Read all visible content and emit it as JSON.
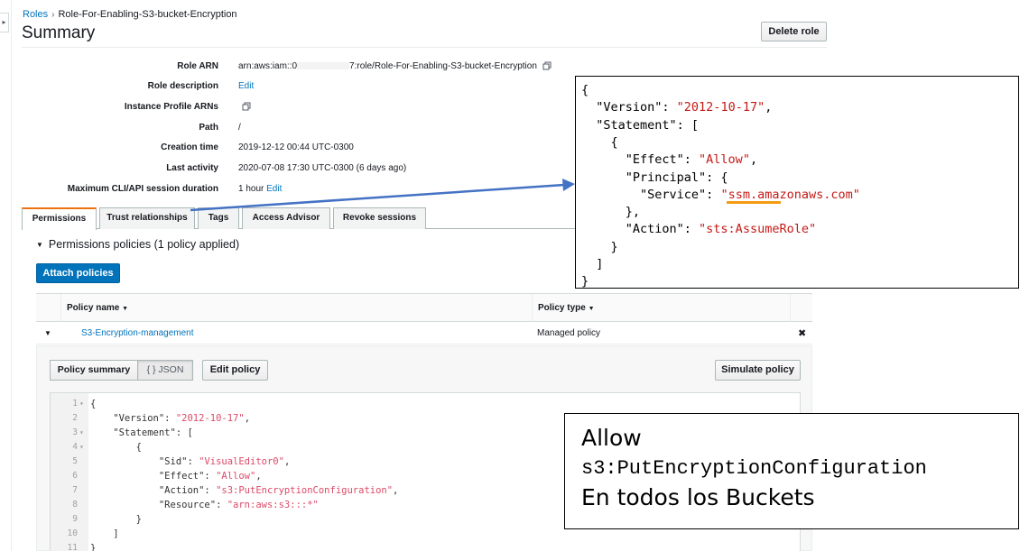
{
  "breadcrumb": {
    "root": "Roles",
    "current": "Role-For-Enabling-S3-bucket-Encryption"
  },
  "page": {
    "title": "Summary",
    "delete_button": "Delete role"
  },
  "summary": {
    "role_arn_label": "Role ARN",
    "role_arn_prefix": "arn:aws:iam::0",
    "role_arn_suffix": "7:role/Role-For-Enabling-S3-bucket-Encryption",
    "role_description_label": "Role description",
    "role_description_edit": "Edit",
    "instance_profile_label": "Instance Profile ARNs",
    "path_label": "Path",
    "path_value": "/",
    "creation_time_label": "Creation time",
    "creation_time_value": "2019-12-12 00:44 UTC-0300",
    "last_activity_label": "Last activity",
    "last_activity_value": "2020-07-08 17:30 UTC-0300 (6 days ago)",
    "max_session_label": "Maximum CLI/API session duration",
    "max_session_value": "1 hour",
    "max_session_edit": "Edit"
  },
  "tabs": [
    "Permissions",
    "Trust relationships",
    "Tags",
    "Access Advisor",
    "Revoke sessions"
  ],
  "permissions": {
    "heading": "Permissions policies (1 policy applied)",
    "attach_button": "Attach policies",
    "col_policy_name": "Policy name",
    "col_policy_type": "Policy type",
    "row_name": "S3-Encryption-management",
    "row_type": "Managed policy",
    "remove_glyph": "✖"
  },
  "policy_panel": {
    "summary_btn": "Policy summary",
    "json_btn": "{ } JSON",
    "edit_btn": "Edit policy",
    "simulate_btn": "Simulate policy"
  },
  "editor_lines": [
    {
      "n": "1",
      "fold": "▾",
      "pre": "{",
      "str": "",
      "post": ""
    },
    {
      "n": "2",
      "fold": "",
      "pre": "    \"Version\": ",
      "str": "\"2012-10-17\"",
      "post": ","
    },
    {
      "n": "3",
      "fold": "▾",
      "pre": "    \"Statement\": [",
      "str": "",
      "post": ""
    },
    {
      "n": "4",
      "fold": "▾",
      "pre": "        {",
      "str": "",
      "post": ""
    },
    {
      "n": "5",
      "fold": "",
      "pre": "            \"Sid\": ",
      "str": "\"VisualEditor0\"",
      "post": ","
    },
    {
      "n": "6",
      "fold": "",
      "pre": "            \"Effect\": ",
      "str": "\"Allow\"",
      "post": ","
    },
    {
      "n": "7",
      "fold": "",
      "pre": "            \"Action\": ",
      "str": "\"s3:PutEncryptionConfiguration\"",
      "post": ","
    },
    {
      "n": "8",
      "fold": "",
      "pre": "            \"Resource\": ",
      "str": "\"arn:aws:s3:::*\"",
      "post": ""
    },
    {
      "n": "9",
      "fold": "",
      "pre": "        }",
      "str": "",
      "post": ""
    },
    {
      "n": "10",
      "fold": "",
      "pre": "    ]",
      "str": "",
      "post": ""
    },
    {
      "n": "11",
      "fold": "",
      "pre": "}",
      "str": "",
      "post": ""
    }
  ],
  "trust_popup_lines": [
    {
      "pre": "{",
      "str": "",
      "post": ""
    },
    {
      "pre": "  \"Version\": ",
      "str": "\"2012-10-17\"",
      "post": ","
    },
    {
      "pre": "  \"Statement\": [",
      "str": "",
      "post": ""
    },
    {
      "pre": "    {",
      "str": "",
      "post": ""
    },
    {
      "pre": "      \"Effect\": ",
      "str": "\"Allow\"",
      "post": ","
    },
    {
      "pre": "      \"Principal\": {",
      "str": "",
      "post": ""
    },
    {
      "pre": "        \"Service\": ",
      "str": "\"ssm.amazonaws.com\"",
      "post": ""
    },
    {
      "pre": "      },",
      "str": "",
      "post": ""
    },
    {
      "pre": "      \"Action\": ",
      "str": "\"sts:AssumeRole\"",
      "post": ""
    },
    {
      "pre": "    }",
      "str": "",
      "post": ""
    },
    {
      "pre": "  ]",
      "str": "",
      "post": ""
    },
    {
      "pre": "}",
      "str": "",
      "post": ""
    }
  ],
  "caption": {
    "line1": "Allow",
    "line2": "s3:PutEncryptionConfiguration",
    "line3": "En todos los Buckets"
  },
  "colors": {
    "link": "#0073bb",
    "primary_button": "#0073bb",
    "active_tab_accent": "#ec7211",
    "arrow": "#4472c4",
    "highlight_underline": "#f39c12"
  },
  "icons": [
    "copy-icon",
    "caret-down-icon",
    "close-icon",
    "sidebar-toggle-icon"
  ]
}
